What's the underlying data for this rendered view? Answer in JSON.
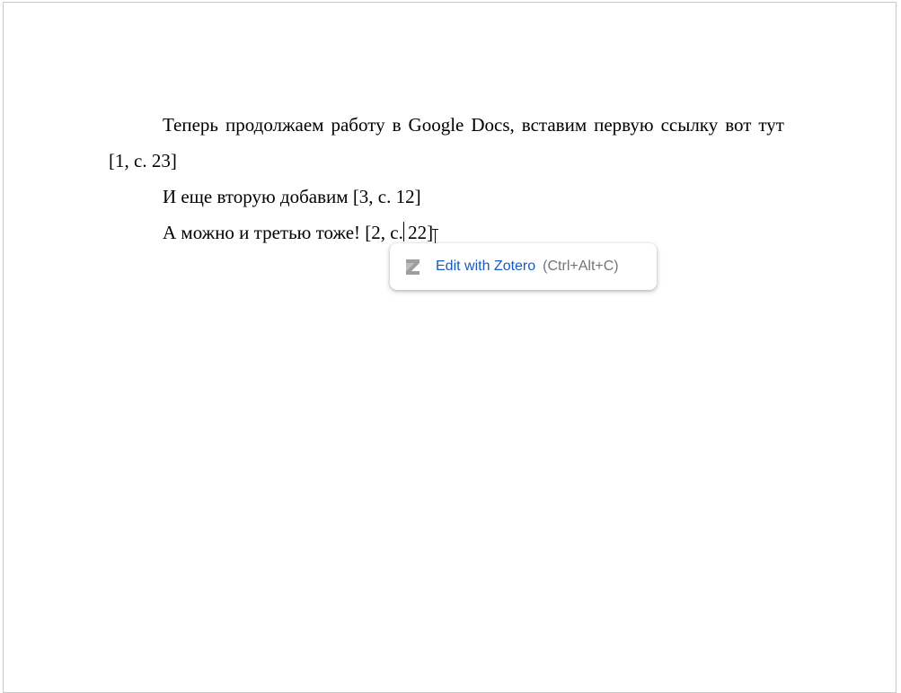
{
  "document": {
    "paragraphs": [
      {
        "text": "Теперь продолжаем работу в Google Docs, вставим первую ссылку вот тут [1, с. 23]"
      },
      {
        "text": "И еще вторую добавим [3, с. 12]"
      },
      {
        "before_cursor": "А можно и третью тоже! [2, с.",
        "after_cursor": " 22]"
      }
    ]
  },
  "popup": {
    "icon": "zotero-z-icon",
    "label": "Edit with Zotero",
    "shortcut": "(Ctrl+Alt+C)"
  },
  "colors": {
    "link_blue": "#185abc",
    "shortcut_gray": "#70757a",
    "icon_gray": "#9e9e9e"
  }
}
